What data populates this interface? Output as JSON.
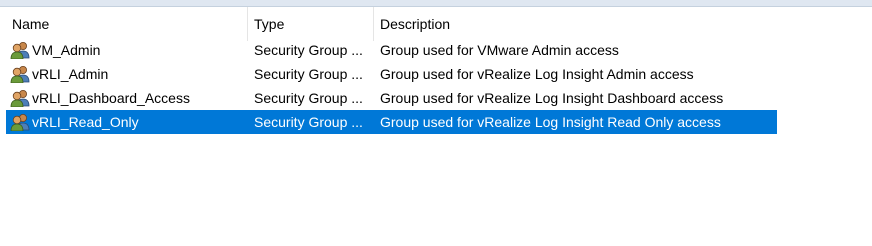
{
  "columns": {
    "name": "Name",
    "type": "Type",
    "description": "Description"
  },
  "rows": [
    {
      "icon": "security-group-icon",
      "name": "VM_Admin",
      "type": "Security Group ...",
      "description": "Group used for VMware Admin access",
      "selected": false
    },
    {
      "icon": "security-group-icon",
      "name": "vRLI_Admin",
      "type": "Security Group ...",
      "description": "Group used for vRealize Log Insight Admin access",
      "selected": false
    },
    {
      "icon": "security-group-icon",
      "name": "vRLI_Dashboard_Access",
      "type": "Security Group ...",
      "description": "Group used for vRealize Log Insight Dashboard access",
      "selected": false
    },
    {
      "icon": "security-group-icon",
      "name": "vRLI_Read_Only",
      "type": "Security Group ...",
      "description": "Group used for vRealize Log Insight Read Only access",
      "selected": true
    }
  ],
  "colors": {
    "selection": "#0078d7",
    "header_separator": "#e5e5e5"
  }
}
